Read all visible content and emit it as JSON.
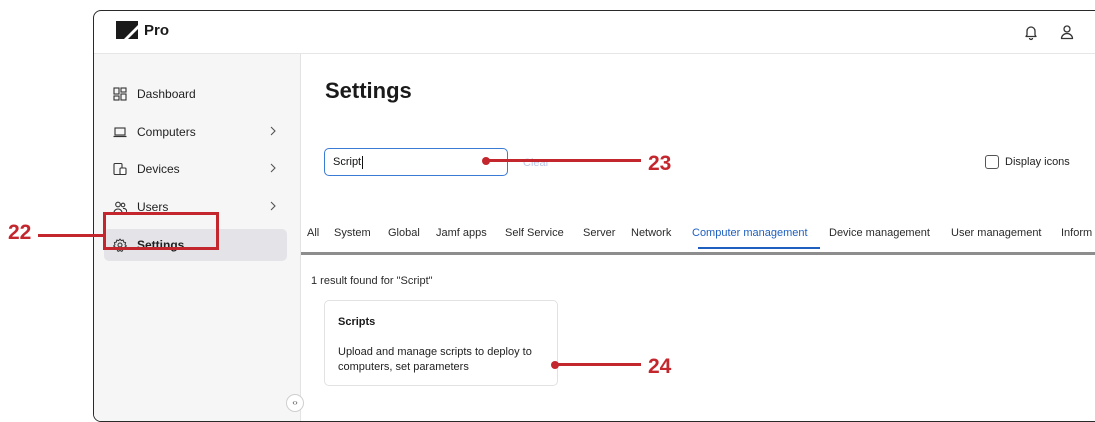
{
  "app": {
    "brand": "Pro"
  },
  "sidebar": {
    "items": [
      {
        "label": "Dashboard",
        "icon": "dashboard-icon",
        "has_chevron": false
      },
      {
        "label": "Computers",
        "icon": "laptop-icon",
        "has_chevron": true
      },
      {
        "label": "Devices",
        "icon": "devices-icon",
        "has_chevron": true
      },
      {
        "label": "Users",
        "icon": "users-icon",
        "has_chevron": true
      },
      {
        "label": "Settings",
        "icon": "gear-icon",
        "has_chevron": false,
        "active": true
      }
    ],
    "collapse_glyph": "‹›"
  },
  "main": {
    "title": "Settings",
    "search": {
      "value": "Script",
      "clear_label": "Clear"
    },
    "display_icons_label": "Display icons",
    "display_icons_checked": false,
    "tabs": [
      "All",
      "System",
      "Global",
      "Jamf apps",
      "Self Service",
      "Server",
      "Network",
      "Computer management",
      "Device management",
      "User management",
      "Inform"
    ],
    "active_tab": "Computer management",
    "result_count": "1 result found for \"Script\"",
    "result": {
      "title": "Scripts",
      "description": "Upload and manage scripts to deploy to computers, set parameters"
    }
  },
  "callouts": {
    "c22": "22",
    "c23": "23",
    "c24": "24"
  },
  "colors": {
    "accent": "#1e5fbf",
    "callout": "#c4262e",
    "sidebar_active": "#e4e4e8"
  }
}
